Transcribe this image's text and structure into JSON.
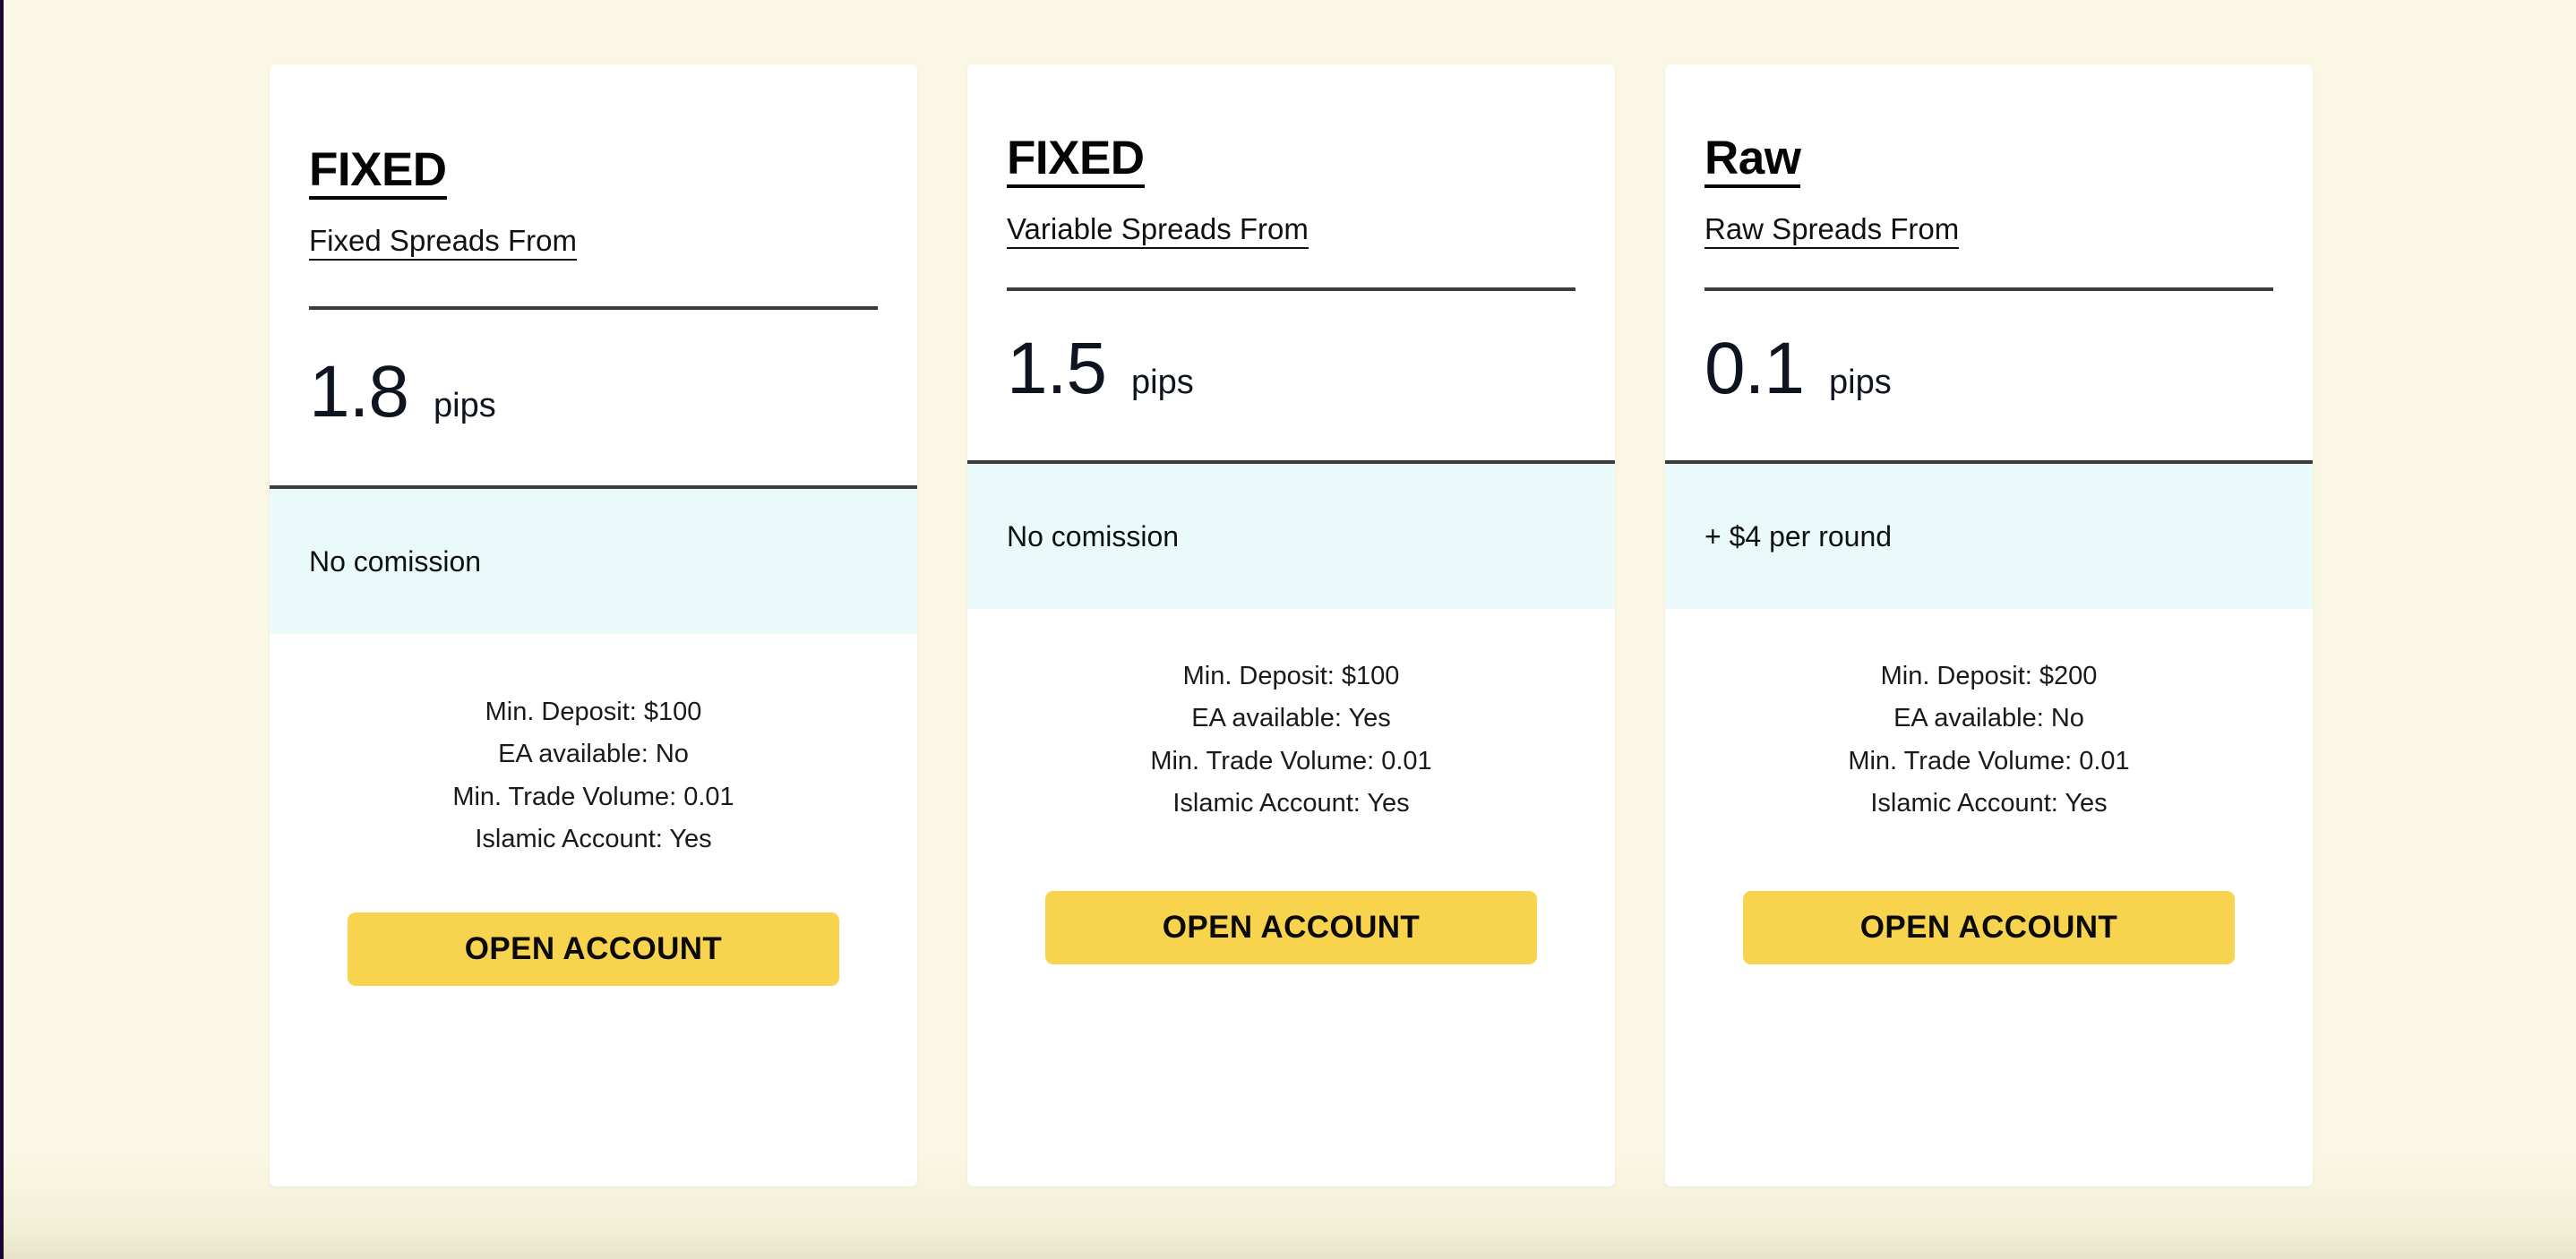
{
  "theme": {
    "page_background": "#FAF7E4",
    "card_background": "#FFFFFF",
    "divider_color": "#3C3C3C",
    "commission_band_color": "#EAFAFA",
    "button_color": "#F8D34D",
    "button_text_color": "#0A0A0A",
    "text_color": "#111111",
    "edge_strip_color": "#1B0533"
  },
  "cards": [
    {
      "title": "FIXED",
      "subtitle": "Fixed Spreads From",
      "price_value": "1.8",
      "price_unit": "pips",
      "commission": "No comission",
      "specs": [
        "Min. Deposit: $100",
        "EA available: No",
        "Min. Trade Volume: 0.01",
        "Islamic Account: Yes"
      ],
      "cta_label": "OPEN ACCOUNT"
    },
    {
      "title": "FIXED",
      "subtitle": "Variable Spreads From",
      "price_value": "1.5",
      "price_unit": "pips",
      "commission": "No comission",
      "specs": [
        "Min. Deposit: $100",
        "EA available: Yes",
        "Min. Trade Volume: 0.01",
        "Islamic Account: Yes"
      ],
      "cta_label": "OPEN ACCOUNT"
    },
    {
      "title": "Raw",
      "subtitle": "Raw Spreads From",
      "price_value": "0.1",
      "price_unit": "pips",
      "commission": "+ $4 per round",
      "specs": [
        "Min. Deposit: $200",
        "EA available: No",
        "Min. Trade Volume: 0.01",
        "Islamic Account: Yes"
      ],
      "cta_label": "OPEN ACCOUNT"
    }
  ]
}
